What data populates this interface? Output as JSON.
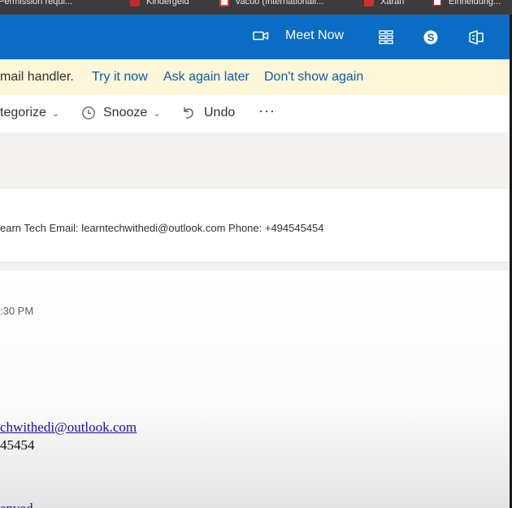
{
  "browser_tabs": [
    {
      "label": "Permission requi...",
      "fav_color": "#d93025"
    },
    {
      "label": "Kindergeld",
      "fav_color": "#c62828"
    },
    {
      "label": "vacuo (Internationali...",
      "fav_color": "#e53935"
    },
    {
      "label": "Xaran",
      "fav_color": "#d32f2f"
    },
    {
      "label": "Einheldung...",
      "fav_color": "#b71c1c"
    }
  ],
  "topbar": {
    "meet_now_label": "Meet Now",
    "meet_icon": "video-camera-icon",
    "icons": [
      "apps-grid-icon",
      "skype-icon",
      "office-icon"
    ]
  },
  "notice": {
    "message": "mail handler.",
    "try_it_now": "Try it now",
    "ask_again_later": "Ask again later",
    "dont_show_again": "Don't show again"
  },
  "toolbar": {
    "categorize_label": "tegorize",
    "snooze_label": "Snooze",
    "undo_label": "Undo",
    "more_label": "···"
  },
  "message_preview": {
    "text": "earn Tech Email: learntechwithedi@outlook.com Phone: +494545454"
  },
  "message_body": {
    "time": ":30 PM",
    "signature_email": "chwithedi@outlook.com",
    "signature_phone": "45454",
    "bottom_link": "anved"
  },
  "colors": {
    "accent": "#0a6cc4",
    "notice_bg": "#fdf6d8",
    "link": "#0b5cad"
  }
}
